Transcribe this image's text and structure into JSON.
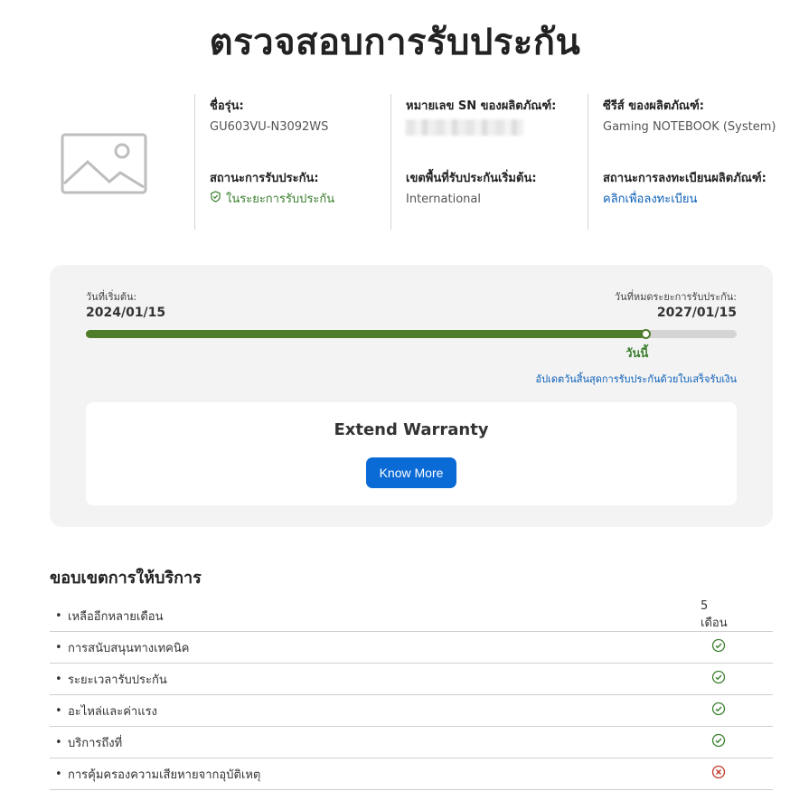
{
  "page": {
    "title": "ตรวจสอบการรับประกัน"
  },
  "product": {
    "image_icon": "image-placeholder-icon",
    "model_label": "ชื่อรุ่น:",
    "model_value": "GU603VU-N3092WS",
    "sn_label": "หมายเลข SN ของผลิตภัณฑ์:",
    "series_label": "ซีรีส์ ของผลิตภัณฑ์:",
    "series_value": "Gaming NOTEBOOK (System)",
    "status_label": "สถานะการรับประกัน:",
    "status_value": "ในระยะการรับประกัน",
    "status_icon": "shield-check-icon",
    "region_label": "เขตพื้นที่รับประกันเริ่มต้น:",
    "region_value": "International",
    "registration_label": "สถานะการลงทะเบียนผลิตภัณฑ์:",
    "registration_link": "คลิกเพื่อลงทะเบียน"
  },
  "warranty": {
    "start_label": "วันที่เริ่มต้น:",
    "start_date": "2024/01/15",
    "end_label": "วันที่หมดระยะการรับประกัน:",
    "end_date": "2027/01/15",
    "progress_fraction": 0.86,
    "today_label": "วันนี้",
    "update_link": "อัปเดตวันสิ้นสุดการรับประกันด้วยใบเสร็จรับเงิน",
    "extend_title": "Extend Warranty",
    "extend_button": "Know More"
  },
  "colors": {
    "green": "#4f7c2a",
    "link": "#0b5fb8",
    "button": "#0a6ad6",
    "cross": "#c0392b"
  },
  "services": {
    "heading": "ขอบเขตการให้บริการ",
    "rows": [
      {
        "label": "เหลืออีกหลายเดือน",
        "value": "5 เดือน",
        "icon": ""
      },
      {
        "label": "การสนับสนุนทางเทคนิค",
        "value": "",
        "icon": "check-circle-icon"
      },
      {
        "label": "ระยะเวลารับประกัน",
        "value": "",
        "icon": "check-circle-icon"
      },
      {
        "label": "อะไหล่และค่าแรง",
        "value": "",
        "icon": "check-circle-icon"
      },
      {
        "label": "บริการถึงที่",
        "value": "",
        "icon": "check-circle-icon"
      },
      {
        "label": "การคุ้มครองความเสียหายจากอุบัติเหตุ",
        "value": "",
        "icon": "x-circle-icon"
      }
    ]
  }
}
